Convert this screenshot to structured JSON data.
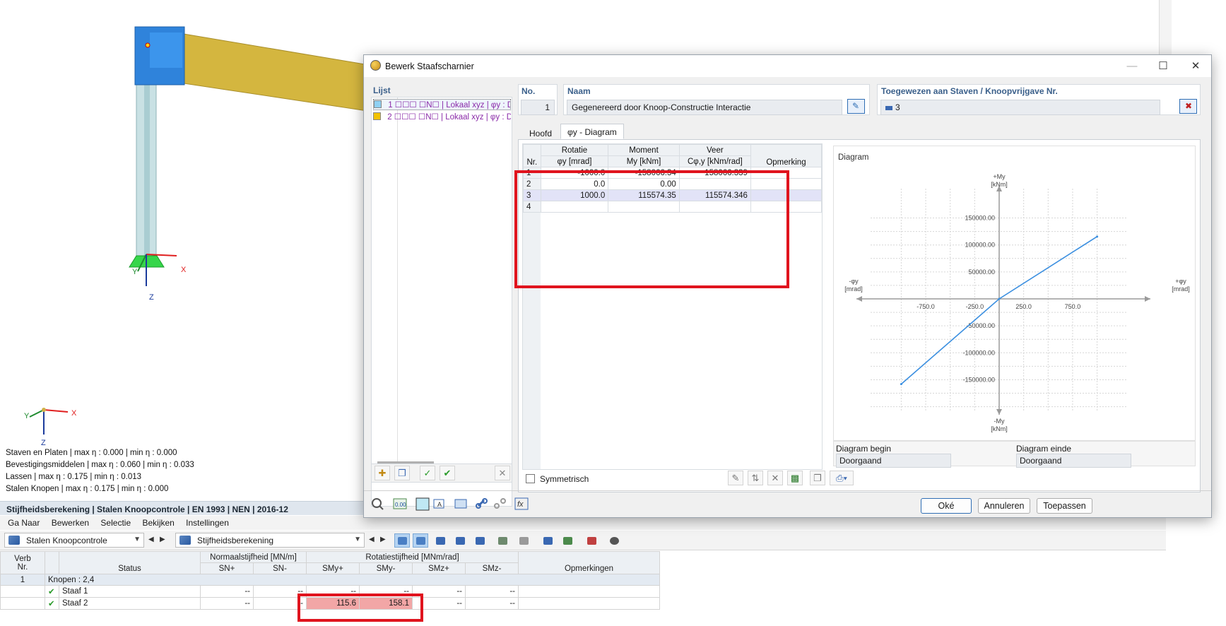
{
  "viewport": {
    "axis_x": "X",
    "axis_y": "Y",
    "axis_z": "Z",
    "status_lines": [
      "Staven en Platen | max η : 0.000 | min η : 0.000",
      "Bevestigingsmiddelen | max η : 0.060 | min η : 0.033",
      "Lassen | max η : 0.175 | min η : 0.013",
      "Stalen Knopen | max η : 0.175 | min η : 0.000"
    ]
  },
  "panel": {
    "title": "Stijfheidsberekening | Stalen Knoopcontrole | EN 1993 | NEN | 2016-12",
    "menu": [
      "Ga Naar",
      "Bewerken",
      "Selectie",
      "Bekijken",
      "Instellingen"
    ],
    "combo_module": "Stalen Knoopcontrole",
    "combo_calc": "Stijfheidsberekening",
    "table": {
      "col_verb": "Verb\nNr.",
      "col_status": "Status",
      "grp_normal": "Normaalstijfheid [MN/m]",
      "grp_rot": "Rotatiestijfheid [MNm/rad]",
      "sub": [
        "SN+",
        "SN-",
        "SMy+",
        "SMy-",
        "SMz+",
        "SMz-"
      ],
      "col_remarks": "Opmerkingen",
      "group_nr": "1",
      "group_label": "Knopen : 2,4",
      "rows": [
        {
          "label": "Staaf 1",
          "sn_plus": "--",
          "sn_min": "--",
          "smy_plus": "--",
          "smy_min": "--",
          "smz_plus": "--",
          "smz_min": "--"
        },
        {
          "label": "Staaf 2",
          "sn_plus": "--",
          "sn_min": "--",
          "smy_plus": "115.6",
          "smy_min": "158.1",
          "smz_plus": "--",
          "smz_min": "--"
        }
      ]
    }
  },
  "dialog": {
    "title": "Bewerk Staafscharnier",
    "list_head": "Lijst",
    "list_items": [
      {
        "text": "1 ☐☐☐ ☐N☐ | Lokaal xyz | φy : D",
        "color": "#8fd0f2"
      },
      {
        "text": "2 ☐☐☐ ☐N☐ | Lokaal xyz | φy : D",
        "color": "#f2c200"
      }
    ],
    "no_head": "No.",
    "no_value": "1",
    "naam_head": "Naam",
    "naam_value": "Gegenereerd door Knoop-Constructie Interactie",
    "assigned_head": "Toegewezen aan Staven / Knoopvrijgave Nr.",
    "assigned_value": "3",
    "tab_main": "Hoofd",
    "tab_diagram": "φy - Diagram",
    "table": {
      "h_nr": "Nr.",
      "h_rot": "Rotatie",
      "h_rot_unit": "φy [mrad]",
      "h_mom": "Moment",
      "h_mom_unit": "My [kNm]",
      "h_veer": "Veer",
      "h_veer_unit": "Cφ,y [kNm/rad]",
      "h_rem": "Opmerking",
      "rows": [
        {
          "nr": "1",
          "rot": "-1000.0",
          "mom": "-158066.34",
          "veer": "158066.339"
        },
        {
          "nr": "2",
          "rot": "0.0",
          "mom": "0.00",
          "veer": ""
        },
        {
          "nr": "3",
          "rot": "1000.0",
          "mom": "115574.35",
          "veer": "115574.346"
        },
        {
          "nr": "4",
          "rot": "",
          "mom": "",
          "veer": ""
        }
      ]
    },
    "symmetric_label": "Symmetrisch",
    "diagram": {
      "title": "Diagram",
      "y_pos": "+My",
      "y_pos_unit": "[kNm]",
      "y_neg": "-My",
      "y_neg_unit": "[kNm]",
      "x_pos": "+φy",
      "x_pos_unit": "[mrad]",
      "x_neg": "-φy",
      "x_neg_unit": "[mrad]",
      "yticks": [
        "150000.00",
        "100000.00",
        "50000.00",
        "-50000.00",
        "-100000.00",
        "-150000.00"
      ],
      "xticks": [
        "-750.0",
        "-250.0",
        "250.0",
        "750.0"
      ]
    },
    "chart_data": {
      "type": "line",
      "x": [
        -1000.0,
        0.0,
        1000.0
      ],
      "y": [
        -158066.34,
        0.0,
        115574.35
      ],
      "xlabel": "φy [mrad]",
      "ylabel": "My [kNm]",
      "color": "#3b8fe0"
    },
    "begin_label": "Diagram begin",
    "begin_value": "Doorgaand",
    "end_label": "Diagram einde",
    "end_value": "Doorgaand",
    "btn_ok": "Oké",
    "btn_cancel": "Annuleren",
    "btn_apply": "Toepassen"
  }
}
